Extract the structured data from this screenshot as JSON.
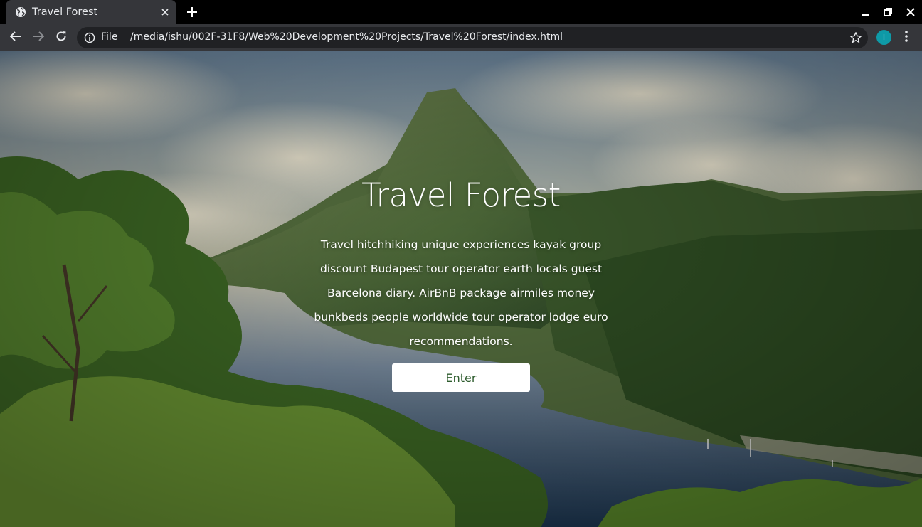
{
  "browser": {
    "tab_title": "Travel Forest",
    "address": {
      "scheme_label": "File",
      "url": "/media/ishu/002F-31F8/Web%20Development%20Projects/Travel%20Forest/index.html"
    },
    "profile_initial": "I",
    "colors": {
      "frame": "#000000",
      "toolbar": "#35363a",
      "omnibox": "#202124",
      "avatar": "#0e9aa7"
    },
    "icons": [
      "globe-icon",
      "close-icon",
      "plus-icon",
      "minimize-icon",
      "restore-icon",
      "window-close-icon",
      "back-icon",
      "forward-icon",
      "reload-icon",
      "info-icon",
      "star-icon",
      "kebab-menu-icon"
    ]
  },
  "hero": {
    "title": "Travel Forest",
    "description": "Travel hitchhiking unique experiences kayak group discount Budapest tour operator earth locals guest Barcelona diary. AirBnB package airmiles money bunkbeds people worldwide tour operator lodge euro recommendations.",
    "button_label": "Enter",
    "colors": {
      "text": "#ffffff",
      "button_bg": "#ffffff",
      "button_text": "#2f5d2f"
    }
  }
}
